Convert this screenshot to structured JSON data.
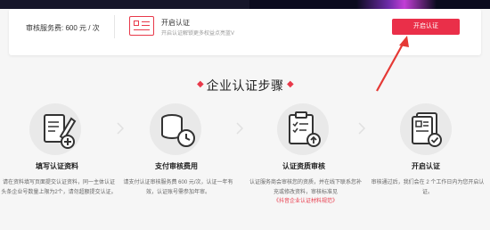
{
  "header": {
    "fee_label": "审核服务费:",
    "fee_value": "600 元 / 次",
    "open_title": "开启认证",
    "open_subtitle": "开启认证解锁更多权益点亮蓝V",
    "open_button": "开启认证"
  },
  "section": {
    "title": "企业认证步骤",
    "deco_left": "◆",
    "deco_right": "◆"
  },
  "steps": [
    {
      "title": "填写认证资料",
      "desc": "请在资料填写页面提交认证资料，同一主体认证头条企业号数量上限为2个，请勿超额提交认证。",
      "icon": "pencil-form-icon"
    },
    {
      "title": "支付审核费用",
      "desc": "请支付认证审核服务费 600 元/次，认证一年有效，认证账号需参加年审。",
      "icon": "coins-clock-icon"
    },
    {
      "title": "认证资质审核",
      "desc": "认证服务商会审核您的资质，并在线下联系您补充或修改资料，审核标准见",
      "link": "《抖音企业认证材料规范》",
      "icon": "clipboard-upload-icon"
    },
    {
      "title": "开启认证",
      "desc": "审核通过后，我们会在 2 个工作日内为您开启认证。",
      "icon": "document-check-icon"
    }
  ],
  "colors": {
    "accent": "#ea2f49",
    "background": "#f6f6f6",
    "card": "#ffffff"
  }
}
